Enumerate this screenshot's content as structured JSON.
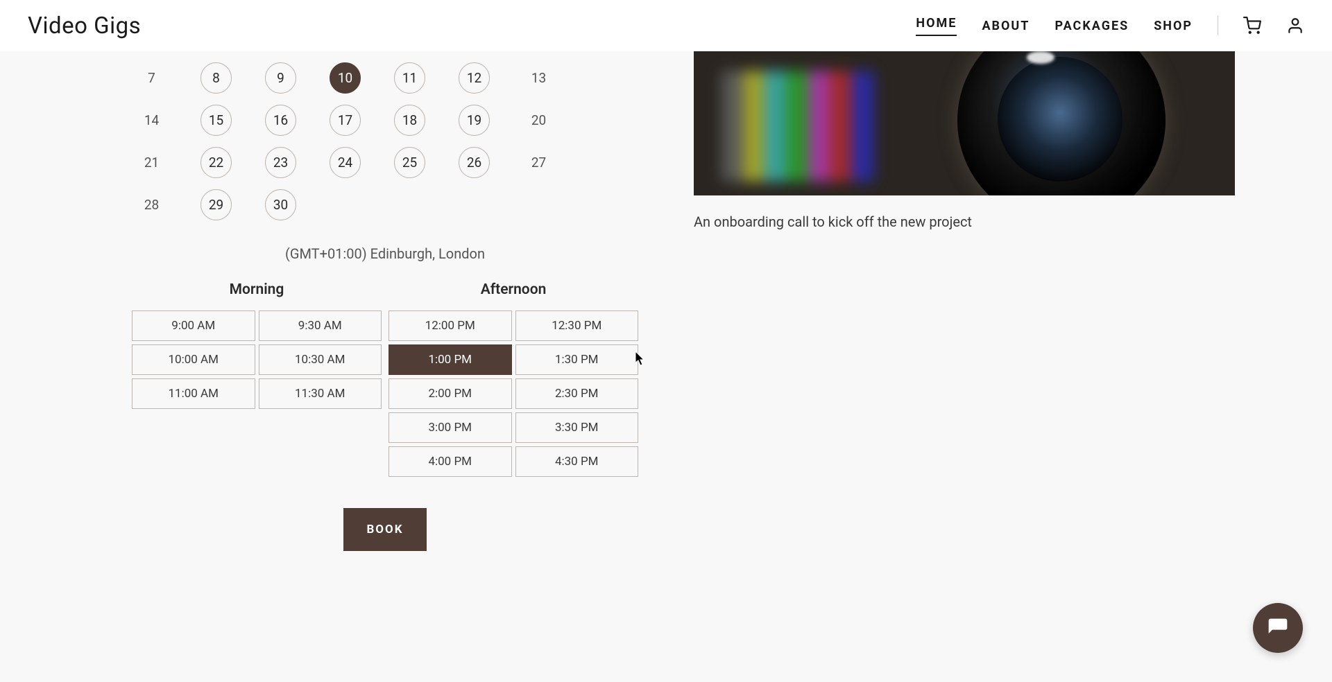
{
  "brand": "Video Gigs",
  "nav": {
    "home": "HOME",
    "about": "ABOUT",
    "packages": "PACKAGES",
    "shop": "SHOP"
  },
  "calendar": {
    "rows": [
      [
        {
          "n": "7",
          "circled": false
        },
        {
          "n": "8",
          "circled": true
        },
        {
          "n": "9",
          "circled": true
        },
        {
          "n": "10",
          "circled": true,
          "selected": true
        },
        {
          "n": "11",
          "circled": true
        },
        {
          "n": "12",
          "circled": true
        },
        {
          "n": "13",
          "circled": false
        }
      ],
      [
        {
          "n": "14",
          "circled": false
        },
        {
          "n": "15",
          "circled": true
        },
        {
          "n": "16",
          "circled": true
        },
        {
          "n": "17",
          "circled": true
        },
        {
          "n": "18",
          "circled": true
        },
        {
          "n": "19",
          "circled": true
        },
        {
          "n": "20",
          "circled": false
        }
      ],
      [
        {
          "n": "21",
          "circled": false
        },
        {
          "n": "22",
          "circled": true
        },
        {
          "n": "23",
          "circled": true
        },
        {
          "n": "24",
          "circled": true
        },
        {
          "n": "25",
          "circled": true
        },
        {
          "n": "26",
          "circled": true
        },
        {
          "n": "27",
          "circled": false
        }
      ],
      [
        {
          "n": "28",
          "circled": false
        },
        {
          "n": "29",
          "circled": true
        },
        {
          "n": "30",
          "circled": true
        }
      ]
    ]
  },
  "timezone": "(GMT+01:00) Edinburgh, London",
  "slots": {
    "morning_label": "Morning",
    "afternoon_label": "Afternoon",
    "morning": [
      "9:00 AM",
      "9:30 AM",
      "10:00 AM",
      "10:30 AM",
      "11:00 AM",
      "11:30 AM"
    ],
    "afternoon": [
      "12:00 PM",
      "12:30 PM",
      "1:00 PM",
      "1:30 PM",
      "2:00 PM",
      "2:30 PM",
      "3:00 PM",
      "3:30 PM",
      "4:00 PM",
      "4:30 PM"
    ],
    "selected": "1:00 PM"
  },
  "book_label": "BOOK",
  "caption": "An onboarding call to kick off the new project",
  "colors": {
    "accent": "#4f3d36"
  }
}
